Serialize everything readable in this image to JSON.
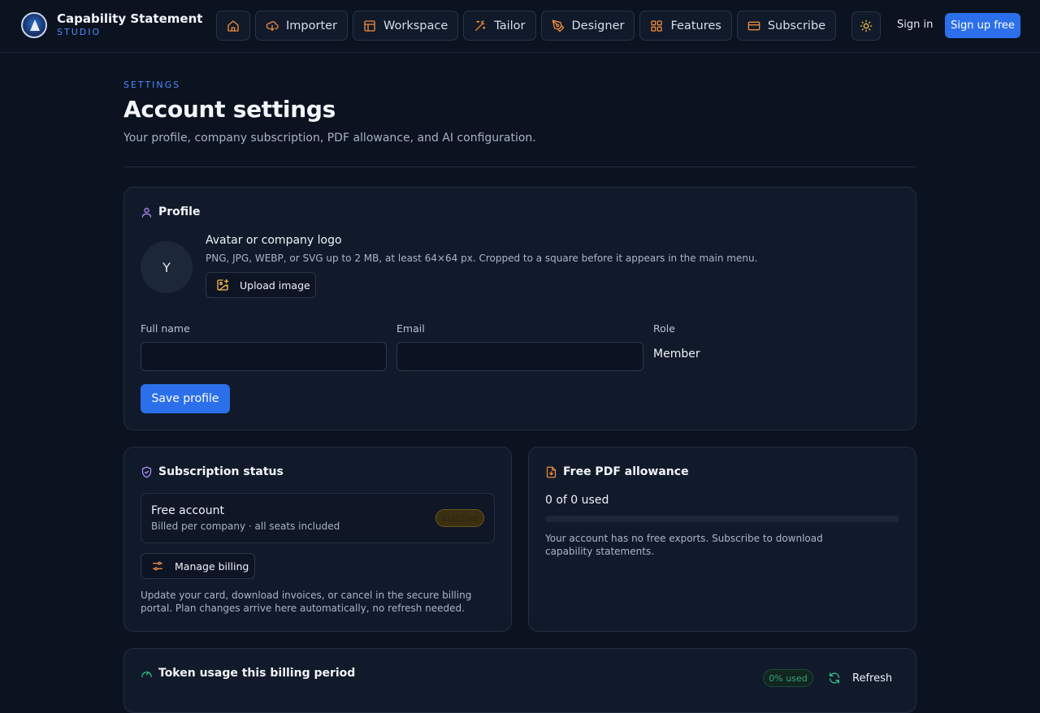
{
  "brand": {
    "title": "Capability Statement",
    "subtitle": "STUDIO"
  },
  "nav": {
    "items": [
      {
        "label": "Importer",
        "icon": "cloud-download-icon"
      },
      {
        "label": "Workspace",
        "icon": "layout-icon"
      },
      {
        "label": "Tailor",
        "icon": "magic-wand-icon"
      },
      {
        "label": "Designer",
        "icon": "pen-tool-icon"
      },
      {
        "label": "Features",
        "icon": "grid-icon"
      },
      {
        "label": "Subscribe",
        "icon": "credit-card-icon"
      }
    ],
    "sign_in": "Sign in",
    "sign_up": "Sign up free"
  },
  "header": {
    "eyebrow": "SETTINGS",
    "title": "Account settings",
    "subtitle": "Your profile, company subscription, PDF allowance, and AI configuration."
  },
  "profile": {
    "heading": "Profile",
    "avatar_initial": "Y",
    "avatar_title": "Avatar or company logo",
    "avatar_hint": "PNG, JPG, WEBP, or SVG up to 2 MB, at least 64×64 px. Cropped to a square before it appears in the main menu.",
    "upload_label": "Upload image",
    "full_name_label": "Full name",
    "full_name_value": "",
    "email_label": "Email",
    "email_value": "",
    "role_label": "Role",
    "role_value": "Member",
    "save_label": "Save profile"
  },
  "subscription": {
    "heading": "Subscription status",
    "plan_name": "Free account",
    "plan_detail": "Billed per company · all seats included",
    "status": "Inactive",
    "manage_label": "Manage billing",
    "note": "Update your card, download invoices, or cancel in the secure billing portal. Plan changes arrive here automatically, no refresh needed."
  },
  "pdf": {
    "heading": "Free PDF allowance",
    "used_text": "0 of 0 used",
    "used_fraction": 0,
    "note": "Your account has no free exports. Subscribe to download capability statements."
  },
  "tokens": {
    "heading": "Token usage this billing period",
    "badge": "0% used",
    "refresh_label": "Refresh"
  },
  "colors": {
    "accent": "#2b6fea",
    "icon_orange": "#f08a3c",
    "icon_purple": "#b48cff",
    "icon_green": "#2fbf8f",
    "warning_badge": "#6b5418"
  }
}
